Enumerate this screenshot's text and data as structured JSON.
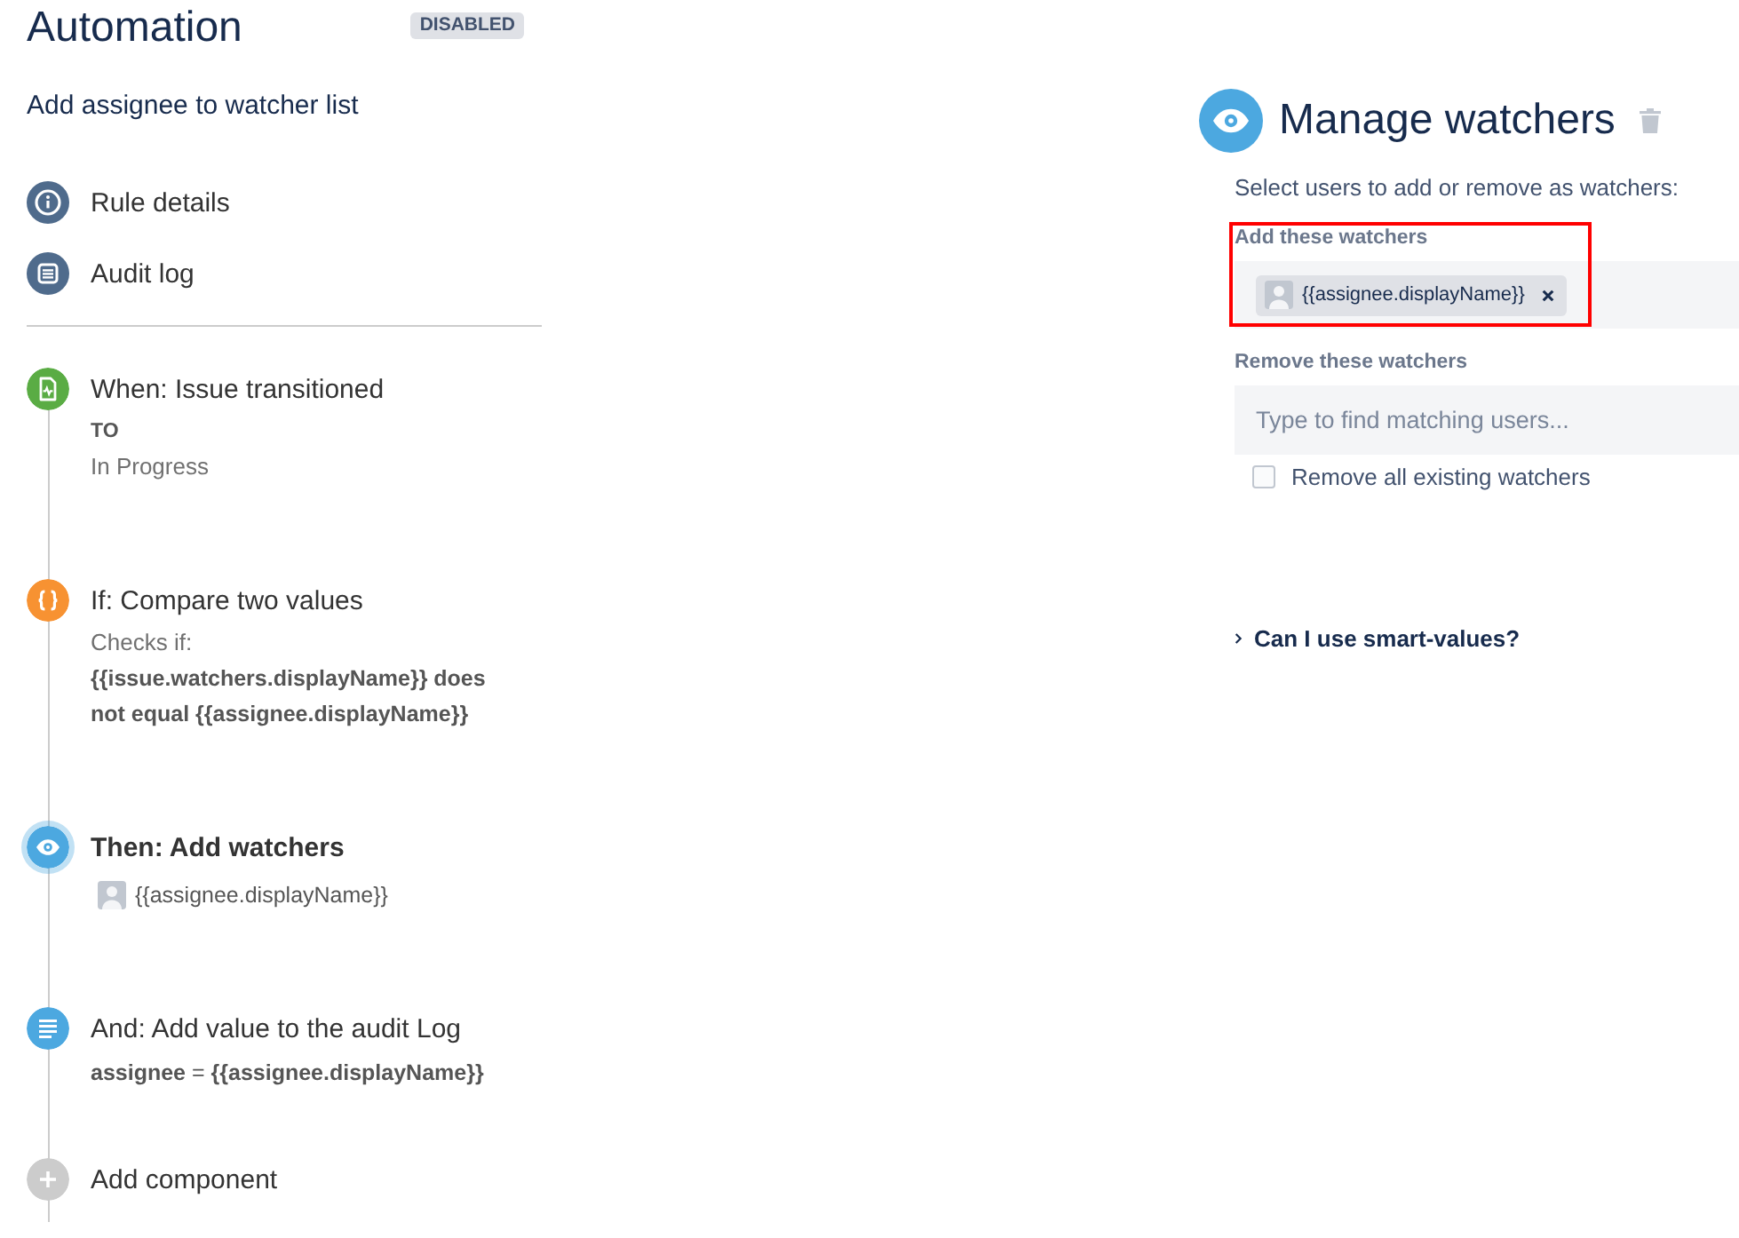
{
  "automation": {
    "title": "Automation",
    "badge": "DISABLED"
  },
  "rule_name": "Add assignee to watcher list",
  "nav": [
    {
      "kind": "info",
      "label": "Rule details"
    },
    {
      "kind": "list",
      "label": "Audit log"
    }
  ],
  "steps": [
    {
      "kind": "trigger",
      "title": "When: Issue transitioned",
      "selected": false,
      "details": [
        {
          "kind": "caption",
          "text": "TO"
        },
        {
          "kind": "value",
          "text": "In Progress"
        }
      ]
    },
    {
      "kind": "condition",
      "title": "If: Compare two values",
      "selected": false,
      "details": [
        {
          "kind": "value",
          "text": "Checks if:"
        },
        {
          "kind": "strong",
          "text": "{{issue.watchers.displayName}} does not equal {{assignee.displayName}}"
        }
      ]
    },
    {
      "kind": "action",
      "title": "Then: Add watchers",
      "selected": true,
      "details": [
        {
          "kind": "user",
          "text": "{{assignee.displayName}}"
        }
      ]
    },
    {
      "kind": "log",
      "title": "And: Add value to the audit Log",
      "selected": false,
      "details": [
        {
          "kind": "rich",
          "text": "**assignee** = **{{assignee.displayName}}**"
        }
      ]
    }
  ],
  "add_component": {
    "label": "Add component"
  },
  "panel": {
    "title": "Manage watchers",
    "intro": "Select users to add or remove as watchers:",
    "add_watchers": {
      "label": "Add these watchers",
      "highlighted": true,
      "users": [
        {
          "name": "{{assignee.displayName}}"
        }
      ]
    },
    "remove_watchers": {
      "label": "Remove these watchers",
      "placeholder": "Type to find matching users..."
    },
    "remove_all": {
      "label": "Remove all existing watchers",
      "checked": false
    },
    "help_link": {
      "label": "Can I use smart-values?",
      "expanded": false
    }
  }
}
